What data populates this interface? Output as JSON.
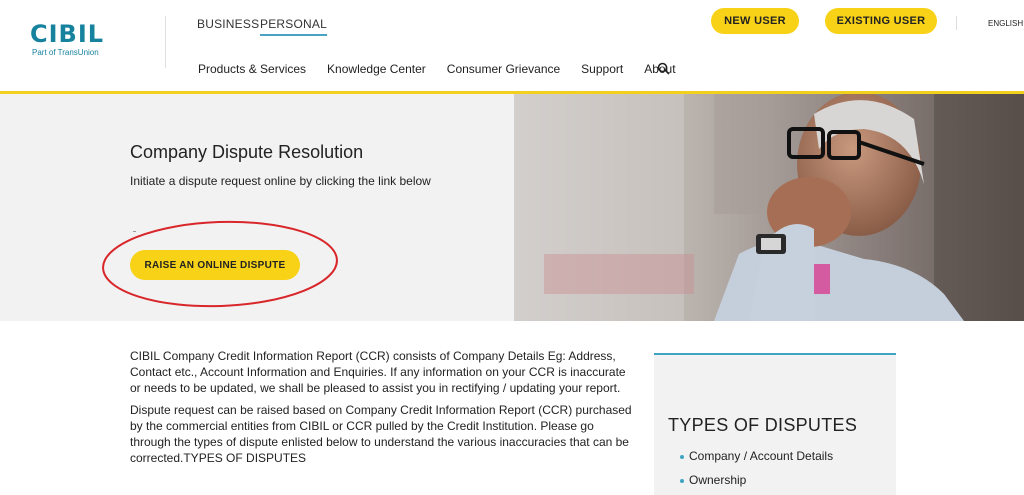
{
  "brand": {
    "logo_text": "CIBIL",
    "logo_sub": "Part of TransUnion",
    "accent": "#16829e",
    "highlight": "#f8d217"
  },
  "header": {
    "segments": [
      "BUSINESS",
      "PERSONAL"
    ],
    "active_segment": "PERSONAL",
    "nav": [
      "Products & Services",
      "Knowledge Center",
      "Consumer Grievance",
      "Support",
      "About"
    ],
    "new_user": "NEW USER",
    "existing_user": "EXISTING USER",
    "language": "ENGLISH",
    "search_icon": "search-icon"
  },
  "hero": {
    "title": "Company Dispute Resolution",
    "subtitle": "Initiate a dispute request online by clicking the link below",
    "button": "RAISE AN ONLINE DISPUTE",
    "annotation_color": "#d8262a"
  },
  "content": {
    "paragraphs": [
      "CIBIL Company Credit Information Report (CCR) consists of Company Details Eg: Address, Contact etc., Account Information and Enquiries. If any information on your CCR is inaccurate or needs to be updated, we shall be pleased to assist you in rectifying / updating your report.",
      "Dispute request can be raised based on Company Credit Information Report (CCR) purchased by the commercial entities from CIBIL or CCR pulled by the Credit Institution. Please go through the types of dispute enlisted below to understand the various inaccuracies that can be corrected.TYPES OF DISPUTES"
    ]
  },
  "sidebar": {
    "title": "TYPES OF DISPUTES",
    "items": [
      "Company / Account Details",
      "Ownership"
    ]
  }
}
